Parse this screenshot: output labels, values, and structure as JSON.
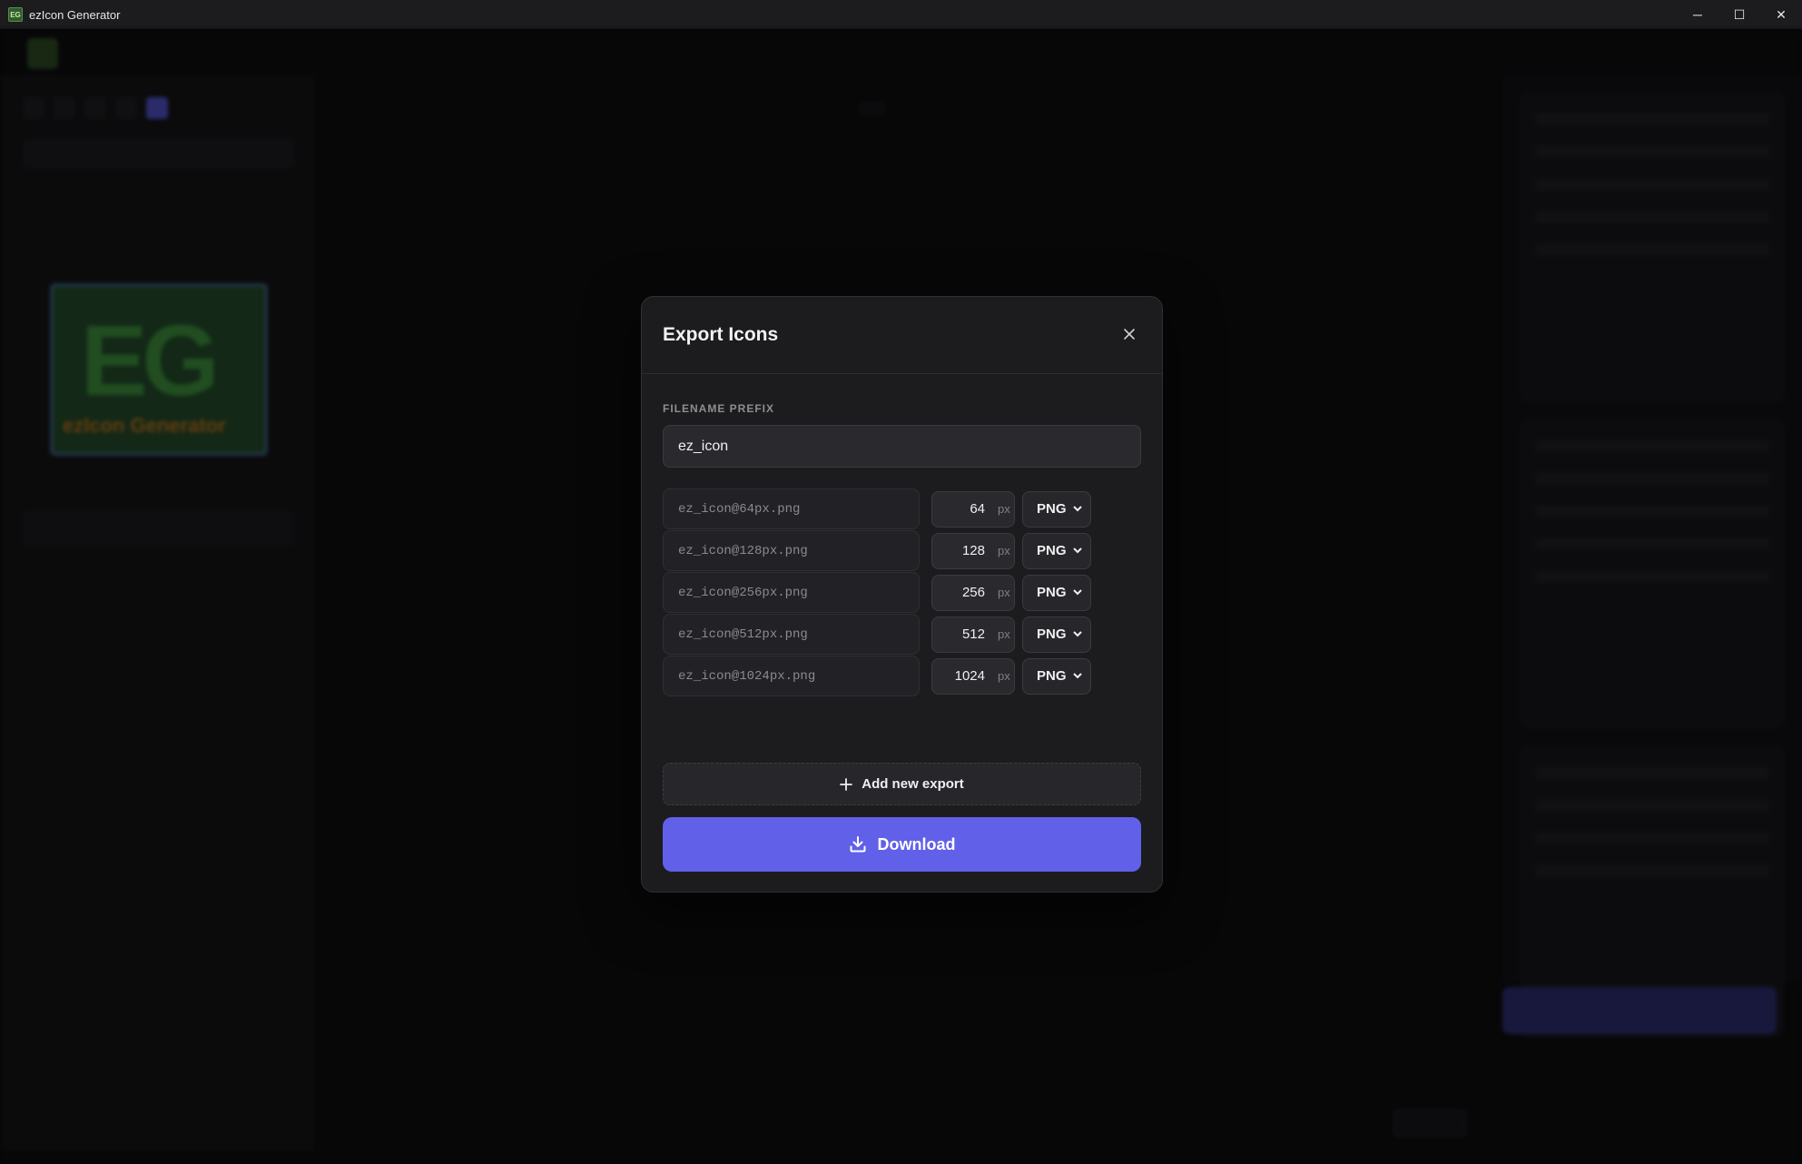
{
  "window": {
    "title": "ezIcon Generator",
    "app_icon_text": "EG",
    "minimize_glyph": "─",
    "maximize_glyph": "☐",
    "close_glyph": "✕"
  },
  "modal": {
    "title": "Export Icons",
    "prefix_label": "FILENAME PREFIX",
    "prefix_value": "ez_icon",
    "exports": [
      {
        "filename": "ez_icon@64px.png",
        "size": "64",
        "unit": "px",
        "format": "PNG"
      },
      {
        "filename": "ez_icon@128px.png",
        "size": "128",
        "unit": "px",
        "format": "PNG"
      },
      {
        "filename": "ez_icon@256px.png",
        "size": "256",
        "unit": "px",
        "format": "PNG"
      },
      {
        "filename": "ez_icon@512px.png",
        "size": "512",
        "unit": "px",
        "format": "PNG"
      },
      {
        "filename": "ez_icon@1024px.png",
        "size": "1024",
        "unit": "px",
        "format": "PNG"
      }
    ],
    "add_label": "Add new export",
    "download_label": "Download"
  },
  "background": {
    "zoom": "100%",
    "preview_letters": "EG",
    "preview_caption": "ezIcon Generator"
  },
  "colors": {
    "accent": "#6060e8",
    "modal_bg": "#1c1c1f"
  }
}
